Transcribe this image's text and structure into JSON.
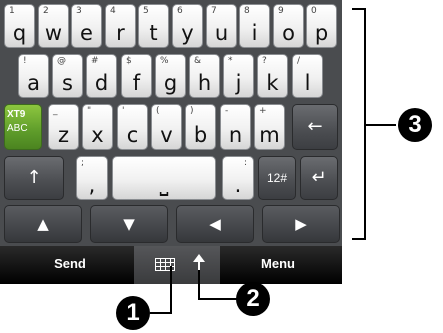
{
  "keyboard": {
    "row1": [
      {
        "num": "1",
        "letter": "q"
      },
      {
        "num": "2",
        "letter": "w"
      },
      {
        "num": "3",
        "letter": "e"
      },
      {
        "num": "4",
        "letter": "r"
      },
      {
        "num": "5",
        "letter": "t"
      },
      {
        "num": "6",
        "letter": "y"
      },
      {
        "num": "7",
        "letter": "u"
      },
      {
        "num": "8",
        "letter": "i"
      },
      {
        "num": "9",
        "letter": "o"
      },
      {
        "num": "0",
        "letter": "p"
      }
    ],
    "row2": [
      {
        "sym": "!",
        "letter": "a"
      },
      {
        "sym": "@",
        "letter": "s"
      },
      {
        "sym": "#",
        "letter": "d"
      },
      {
        "sym": "$",
        "letter": "f"
      },
      {
        "sym": "%",
        "letter": "g"
      },
      {
        "sym": "&",
        "letter": "h"
      },
      {
        "sym": "*",
        "letter": "j"
      },
      {
        "sym": "?",
        "letter": "k"
      },
      {
        "sym": "/",
        "letter": "l"
      }
    ],
    "row3": [
      {
        "sym": "_",
        "letter": "z"
      },
      {
        "sym": "\"",
        "letter": "x"
      },
      {
        "sym": "'",
        "letter": "c"
      },
      {
        "sym": "(",
        "letter": "v"
      },
      {
        "sym": ")",
        "letter": "b"
      },
      {
        "sym": "-",
        "letter": "n"
      },
      {
        "sym": "+",
        "letter": "m"
      }
    ],
    "xt9_label": "XT9",
    "abc_label": "ABC",
    "backspace_glyph": "←",
    "shift_glyph": "↑",
    "semicolon": ";",
    "comma": ",",
    "space_glyph": "⎵",
    "colon": ":",
    "period": ".",
    "num_toggle": "12#",
    "enter_glyph": "↵",
    "up_glyph": "▲",
    "down_glyph": "▼",
    "left_glyph": "◀",
    "right_glyph": "▶"
  },
  "softkeys": {
    "send": "Send",
    "menu": "Menu",
    "input_icon": "keyboard-icon",
    "expand_icon": "up-arrow-icon"
  },
  "callouts": [
    "1",
    "2",
    "3"
  ]
}
